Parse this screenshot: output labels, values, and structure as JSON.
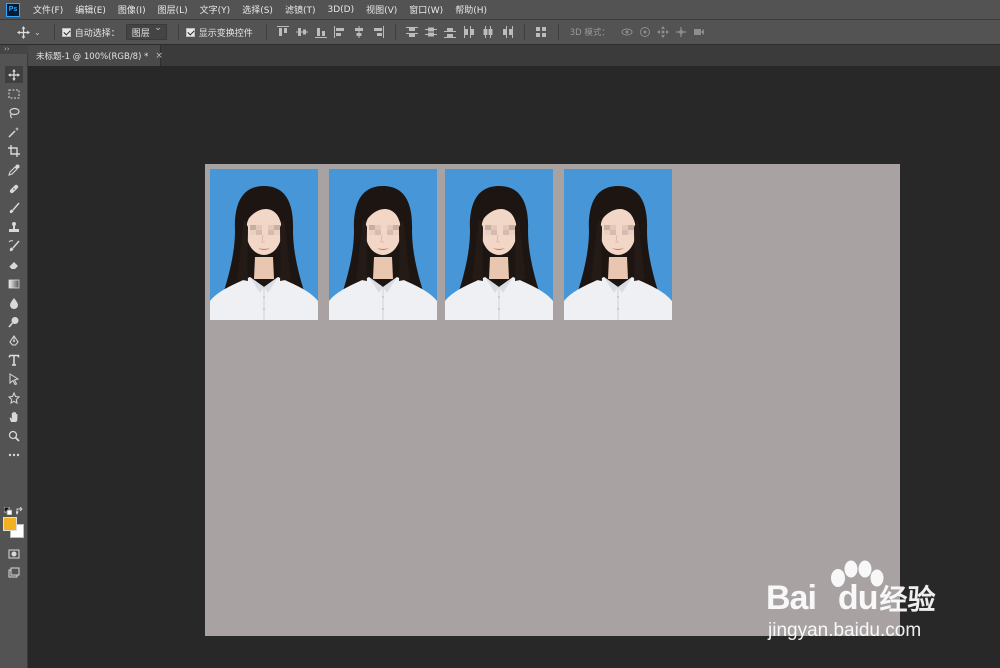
{
  "app": {
    "logo_text": "Ps"
  },
  "menu": {
    "items": [
      {
        "label": "文件(F)"
      },
      {
        "label": "编辑(E)"
      },
      {
        "label": "图像(I)"
      },
      {
        "label": "图层(L)"
      },
      {
        "label": "文字(Y)"
      },
      {
        "label": "选择(S)"
      },
      {
        "label": "滤镜(T)"
      },
      {
        "label": "3D(D)"
      },
      {
        "label": "视图(V)"
      },
      {
        "label": "窗口(W)"
      },
      {
        "label": "帮助(H)"
      }
    ]
  },
  "options": {
    "auto_select_label": "自动选择：",
    "auto_select_checked": true,
    "target_value": "图层",
    "show_transform_label": "显示变换控件",
    "show_transform_checked": true,
    "mode_3d_label": "3D 模式："
  },
  "document": {
    "tab_label": "未标题-1 @ 100%(RGB/8) *",
    "close_glyph": "×",
    "photo_count": 4,
    "photo_bg_color": "#4696d8",
    "canvas_color": "#a8a2a2"
  },
  "colors": {
    "foreground": "#f0b31f",
    "background": "#ffffff",
    "chrome": "#535353",
    "workspace": "#282828"
  },
  "tools": [
    {
      "icon": "move-tool-icon"
    },
    {
      "icon": "marquee-tool-icon"
    },
    {
      "icon": "lasso-tool-icon"
    },
    {
      "icon": "magic-wand-tool-icon"
    },
    {
      "icon": "crop-tool-icon"
    },
    {
      "icon": "eyedropper-tool-icon"
    },
    {
      "icon": "healing-brush-tool-icon"
    },
    {
      "icon": "brush-tool-icon"
    },
    {
      "icon": "clone-stamp-tool-icon"
    },
    {
      "icon": "history-brush-tool-icon"
    },
    {
      "icon": "eraser-tool-icon"
    },
    {
      "icon": "gradient-tool-icon"
    },
    {
      "icon": "blur-tool-icon"
    },
    {
      "icon": "dodge-tool-icon"
    },
    {
      "icon": "pen-tool-icon"
    },
    {
      "icon": "type-tool-icon"
    },
    {
      "icon": "path-selection-tool-icon"
    },
    {
      "icon": "shape-tool-icon"
    },
    {
      "icon": "hand-tool-icon"
    },
    {
      "icon": "zoom-tool-icon"
    },
    {
      "icon": "more-tools-icon"
    }
  ],
  "watermark": {
    "brand_left": "Bai",
    "brand_right": "du",
    "brand_cn": "经验",
    "url": "jingyan.baidu.com"
  }
}
